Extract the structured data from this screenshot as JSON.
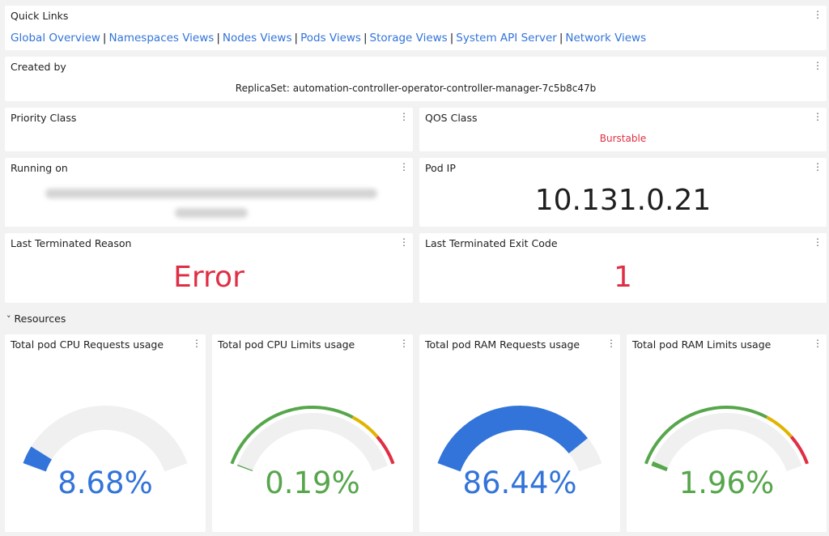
{
  "quick_links": {
    "title": "Quick Links",
    "links": [
      {
        "label": "Global Overview"
      },
      {
        "label": "Namespaces Views"
      },
      {
        "label": "Nodes Views"
      },
      {
        "label": "Pods Views"
      },
      {
        "label": "Storage Views"
      },
      {
        "label": "System API Server"
      },
      {
        "label": "Network Views"
      }
    ],
    "separator": "|"
  },
  "created_by": {
    "title": "Created by",
    "value": "ReplicaSet: automation-controller-operator-controller-manager-7c5b8c47b"
  },
  "priority_class": {
    "title": "Priority Class",
    "value": ""
  },
  "qos_class": {
    "title": "QOS Class",
    "value": "Burstable"
  },
  "running_on": {
    "title": "Running on"
  },
  "pod_ip": {
    "title": "Pod IP",
    "value": "10.131.0.21"
  },
  "last_terminated_reason": {
    "title": "Last Terminated Reason",
    "value": "Error"
  },
  "last_terminated_exit_code": {
    "title": "Last Terminated Exit Code",
    "value": "1"
  },
  "resources_row": {
    "chevron": "˅",
    "title": "Resources"
  },
  "menu_glyph": "⋮",
  "colors": {
    "link": "#3274d9",
    "red": "#e02f44",
    "green": "#56a64b",
    "yellow": "#e0b400",
    "blue": "#3274d9",
    "track": "#f0f0f0"
  },
  "gauges": [
    {
      "title": "Total pod CPU Requests usage",
      "value": 8.68,
      "display": "8.68%",
      "mode": "fill",
      "color": "#3274d9"
    },
    {
      "title": "Total pod CPU Limits usage",
      "value": 0.19,
      "display": "0.19%",
      "mode": "thresholds",
      "color": "#56a64b"
    },
    {
      "title": "Total pod RAM Requests usage",
      "value": 86.44,
      "display": "86.44%",
      "mode": "fill",
      "color": "#3274d9"
    },
    {
      "title": "Total pod RAM Limits usage",
      "value": 1.96,
      "display": "1.96%",
      "mode": "thresholds",
      "color": "#56a64b"
    }
  ],
  "gauge_thresholds": [
    {
      "from": 0,
      "to": 70,
      "color": "#56a64b"
    },
    {
      "from": 70,
      "to": 85,
      "color": "#e0b400"
    },
    {
      "from": 85,
      "to": 100,
      "color": "#e02f44"
    }
  ]
}
